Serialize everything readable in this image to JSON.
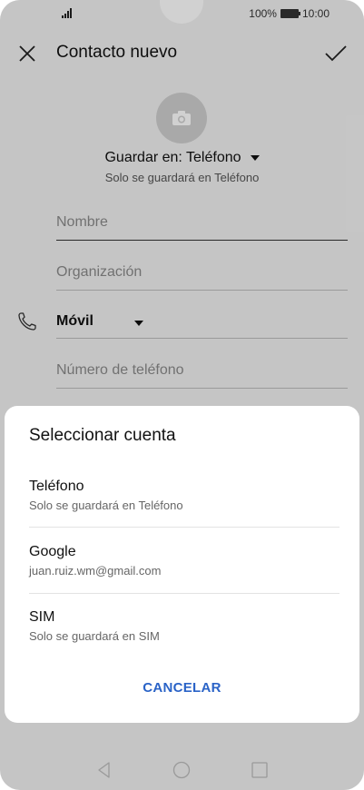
{
  "status_bar": {
    "battery": "100%",
    "time": "10:00"
  },
  "toolbar": {
    "title": "Contacto nuevo"
  },
  "form": {
    "save_to": "Guardar en: Teléfono",
    "save_sub": "Solo se guardará en Teléfono",
    "name_placeholder": "Nombre",
    "org_placeholder": "Organización",
    "phone_type": "Móvil",
    "phone_placeholder": "Número de teléfono"
  },
  "dialog": {
    "title": "Seleccionar cuenta",
    "options": [
      {
        "name": "Teléfono",
        "desc": "Solo se guardará en Teléfono"
      },
      {
        "name": "Google",
        "desc": "juan.ruiz.wm@gmail.com"
      },
      {
        "name": "SIM",
        "desc": "Solo se guardará en SIM"
      }
    ],
    "cancel": "CANCELAR"
  }
}
